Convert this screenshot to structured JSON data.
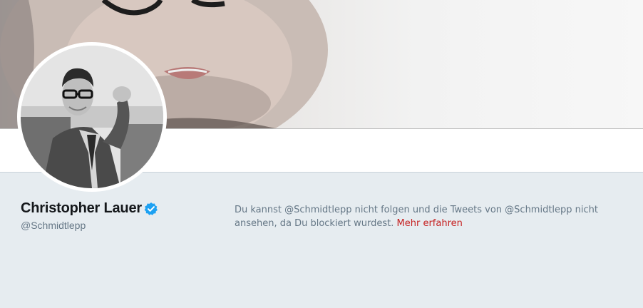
{
  "profile": {
    "display_name": "Christopher Lauer",
    "handle": "@Schmidtlepp",
    "verified": true
  },
  "blocked_notice": {
    "text": "Du kannst @Schmidtlepp nicht folgen und die Tweets von @Schmidtlepp nicht ansehen, da Du blockiert wurdest.",
    "link_label": "Mehr erfahren"
  },
  "colors": {
    "page_background": "#e6ecf0",
    "verified_badge": "#1da1f2",
    "link": "#c51f1f",
    "secondary_text": "#657786"
  },
  "icons": [
    "verified-badge-icon"
  ]
}
